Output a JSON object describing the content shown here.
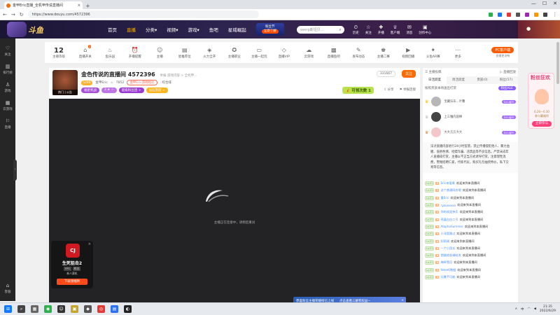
{
  "browser": {
    "tab_title": "金甲Eric直播_全机甲传说直播间",
    "new_tab": "+",
    "url": "https://www.douyu.com/4572396",
    "window_controls": [
      "—",
      "☐",
      "✕"
    ]
  },
  "site": {
    "logo_text": "斗鱼",
    "nav": [
      "首页",
      "直播",
      "分类▾",
      "视频▾",
      "游戏▾",
      "鱼吧",
      "星域崛起"
    ],
    "active_nav_index": 1,
    "festival_title": "粉丝节",
    "festival_btn": "立即了解",
    "search_placeholder": "seerp斯坦贝...",
    "header_icons": [
      {
        "glyph": "⏲",
        "label": "历史"
      },
      {
        "glyph": "☆",
        "label": "关注"
      },
      {
        "glyph": "✚",
        "label": "开播"
      },
      {
        "glyph": "♕",
        "label": "客户端"
      },
      {
        "glyph": "✉",
        "label": "消息"
      },
      {
        "glyph": "▣",
        "label": "创作中心"
      }
    ]
  },
  "left_rail": {
    "items": [
      {
        "glyph": "♡",
        "label": "关注"
      },
      {
        "glyph": "▥",
        "label": "排行榜"
      },
      {
        "glyph": "♙",
        "label": "游戏"
      },
      {
        "glyph": "▦",
        "label": "云游戏"
      },
      {
        "glyph": "⚐",
        "label": "直播"
      }
    ],
    "bottom": {
      "glyph": "⌂",
      "label": "客服"
    },
    "toggle": "›"
  },
  "feature_bar": {
    "level_number": "12",
    "level_label": "主播等级",
    "features": [
      {
        "glyph": "⌂",
        "label": "直播开关",
        "badge": "2"
      },
      {
        "glyph": "♨",
        "label": "鱼乐园",
        "badge": ""
      },
      {
        "glyph": "⏰",
        "label": "开播提醒",
        "badge": ""
      },
      {
        "glyph": "☺",
        "label": "主播",
        "badge": ""
      },
      {
        "glyph": "▤",
        "label": "星推荐位",
        "badge": ""
      },
      {
        "glyph": "◈",
        "label": "火力全开",
        "badge": ""
      },
      {
        "glyph": "✪",
        "label": "主播职业",
        "badge": ""
      },
      {
        "glyph": "▭",
        "label": "主播一起玩",
        "badge": ""
      },
      {
        "glyph": "◇",
        "label": "直播VIP",
        "badge": ""
      },
      {
        "glyph": "☁",
        "label": "云游戏",
        "badge": ""
      },
      {
        "glyph": "▩",
        "label": "直播鱼吧",
        "badge": ""
      },
      {
        "glyph": "✎",
        "label": "发布动态",
        "badge": ""
      },
      {
        "glyph": "♚",
        "label": "主播二赛",
        "badge": ""
      },
      {
        "glyph": "▶",
        "label": "视频回播",
        "badge": ""
      },
      {
        "glyph": "✦",
        "label": "斗鱼AR赛",
        "badge": ""
      },
      {
        "glyph": "⋯",
        "label": "更多",
        "badge": ""
      }
    ],
    "pc_client_btn": "PC客户端",
    "pc_client_sub": "直播更流畅"
  },
  "streamer": {
    "avatar_tag": "热门 | 公告",
    "room_title": "金色传说的直播间 4572396",
    "room_extra": "举报  游戏内容 > 全机甲...",
    "level_pill": "V/99",
    "name": "金甲Eric",
    "hot_label": "7852",
    "red_pill": "金甲Eric游戏经验",
    "follow_sub": "· 综合排",
    "tags": [
      {
        "text": "福星机战",
        "color": "#a84fd8"
      },
      {
        "text": "3 ★ ☆",
        "color": "#c075e6"
      },
      {
        "text": "超级粉丝团 >",
        "color": "#9b3ad1"
      },
      {
        "text": "钻石贵族 >",
        "color": "#ffb31a"
      }
    ],
    "follow_count": "331667",
    "follow_btn": "关注",
    "lucky_label": "💰 可领次数",
    "lucky_count": "1",
    "share": "分享",
    "report": "举报连接"
  },
  "player": {
    "loading_text": "主播正在连接中，请稍后重试",
    "ad_icon": "CJ",
    "ad_name": "生死狙击2",
    "ad_tags": [
      "FPS",
      "射击"
    ],
    "ad_sub": "新人赛机",
    "ad_download": "下载领福利"
  },
  "right_panel": {
    "top_left": "主播投稿",
    "top_right": "直播回放",
    "tabs": [
      "日活跃度",
      "周活跃度",
      "贵族(0)",
      "粉丝(57)"
    ],
    "active_tab_index": 0,
    "rank_text": "按照贵族本场送出打赏",
    "rank_btn": "粉丝ALE",
    "fans": [
      {
        "name": "宝藏乐乐...叶馨",
        "lvl": "Lv.ugin"
      },
      {
        "name": "上三懂内容棒",
        "lvl": "Lv.ugin"
      },
      {
        "name": "大大方方大大",
        "lvl": "Lv.ugin"
      }
    ],
    "notice": "法讨直播内容进行24小时监管，禁止传播侵犯他人、暴力血腥、低俗色情、招嫖诈骗、违禁品等不良信息。严禁未成年人直播或打赏，主播以不正当方式诱导打赏，注意理性消费，警惕招聘仁爱，代练代玩，购买礼包抽奖特价，私下交易等信息。",
    "chat": [
      {
        "user": "Eric亲爱哥",
        "text": "欢迎来到本直播间"
      },
      {
        "user": "这个普通网名哦",
        "text": "欢迎来到本直播间"
      },
      {
        "user": "重Eric",
        "text": "欢迎来到本直播间"
      },
      {
        "user": "ryouxxxxx",
        "text": "欢迎来到本直播间"
      },
      {
        "user": "你的欢迎快乐",
        "text": "欢迎来到本直播间"
      },
      {
        "user": "亮晶白白二号",
        "text": "欢迎来到本直播间"
      },
      {
        "user": "AlaphaSummer",
        "text": "欢迎来到本直播间"
      },
      {
        "user": "小洋是路过",
        "text": "欢迎来到本直播间"
      },
      {
        "user": "阳雨刚",
        "text": "欢迎来到本直播间"
      },
      {
        "user": "一个小团长",
        "text": "欢迎来到本直播间"
      },
      {
        "user": "锁链结发端结发",
        "text": "欢迎来到本直播间"
      },
      {
        "user": "梅轩雪月",
        "text": "欢迎来到本直播间"
      },
      {
        "user": "fatee6数据",
        "text": "欢迎来到本直播间"
      },
      {
        "user": "元曼不可能",
        "text": "欢迎来到本直播间"
      }
    ],
    "chat_level": "Lv.21"
  },
  "promo": {
    "text1": "恭喜粉丝主播荣耀榜已上线",
    "text2": "点击查看三解积权益~",
    "close": "×"
  },
  "right_ad": {
    "title": "粉丝狂欢",
    "date": "6.26—6.30",
    "sub": "参与赢福利",
    "btn": "立即参与"
  },
  "taskbar": {
    "time": "21:35",
    "date": "2022/6/29",
    "tray_lang": "中",
    "icons": [
      {
        "glyph": "⊞",
        "color": "#1677ff"
      },
      {
        "glyph": "⌕",
        "color": "#444"
      },
      {
        "glyph": "▦",
        "color": "#666"
      },
      {
        "glyph": "◉",
        "color": "#2bb24c"
      },
      {
        "glyph": "☺",
        "color": "#333"
      },
      {
        "glyph": "▣",
        "color": "#c7a52a"
      },
      {
        "glyph": "◆",
        "color": "#555"
      },
      {
        "glyph": "◎",
        "color": "#e53935"
      },
      {
        "glyph": "▤",
        "color": "#2d6ff7"
      },
      {
        "glyph": "◐",
        "color": "#222"
      }
    ]
  },
  "colors": {
    "accent": "#ff6a00",
    "header_bg": "#2d2450",
    "player_bg": "#232326"
  }
}
